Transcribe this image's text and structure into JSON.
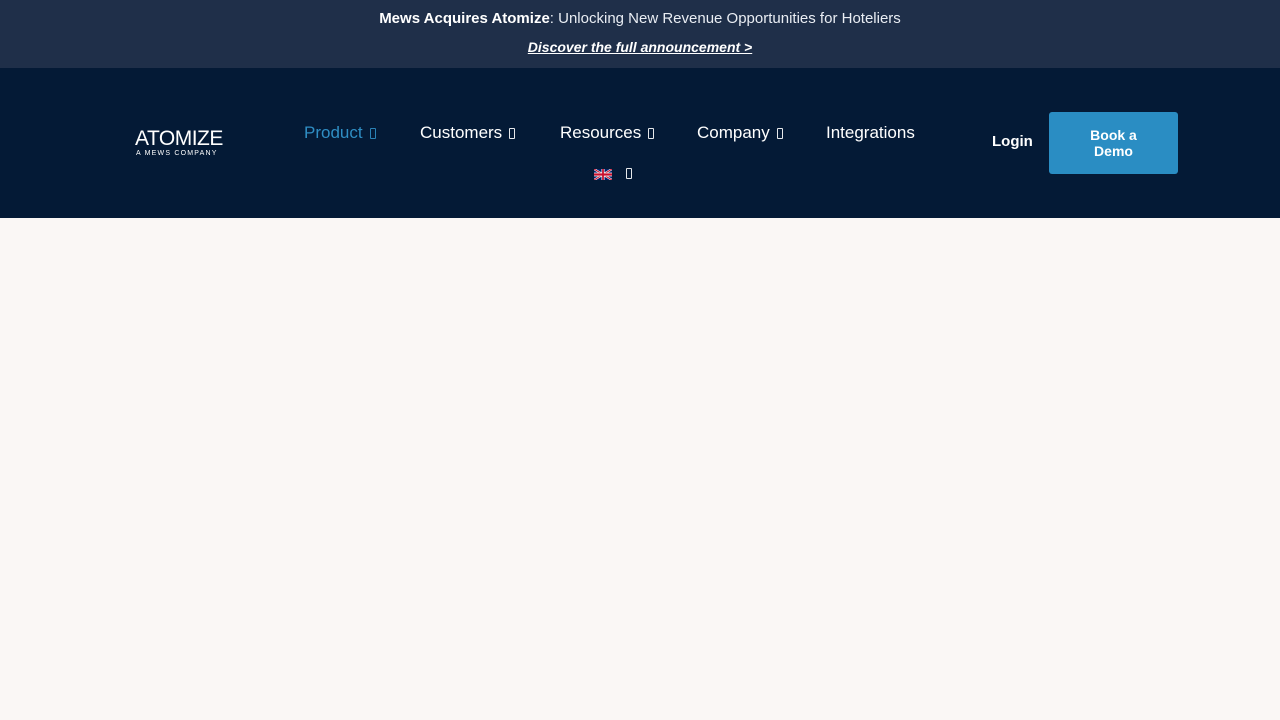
{
  "announcement": {
    "headline_strong": "Mews Acquires Atomize",
    "headline_rest": ": Unlocking New Revenue Opportunities for Hoteliers",
    "link_text": "Discover the full announcement >"
  },
  "logo": {
    "main": "ATOMIZE",
    "sub": "A MEWS COMPANY"
  },
  "nav": {
    "items": [
      {
        "label": "Product",
        "has_dropdown": true,
        "active": true
      },
      {
        "label": "Customers",
        "has_dropdown": true
      },
      {
        "label": "Resources",
        "has_dropdown": true
      },
      {
        "label": "Company",
        "has_dropdown": true
      },
      {
        "label": "Integrations",
        "has_dropdown": false
      }
    ],
    "language_icon": "uk-flag-icon"
  },
  "actions": {
    "login_label": "Login",
    "demo_label": "Book a Demo"
  },
  "colors": {
    "announcement_bg": "#1f2f49",
    "navbar_bg": "#041a36",
    "accent": "#2a8dc3",
    "active_nav": "#2f8ec4",
    "page_bg": "#faf7f5"
  }
}
